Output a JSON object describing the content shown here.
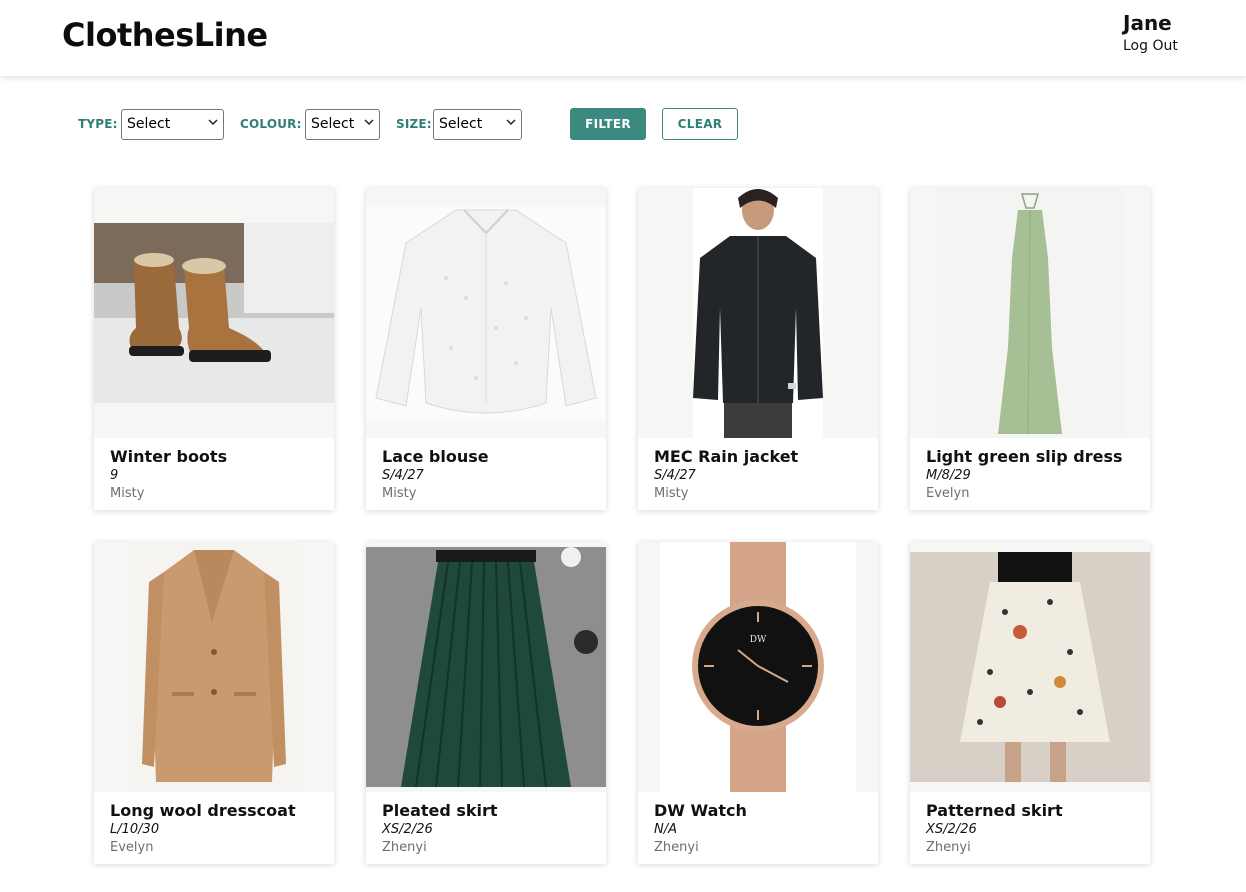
{
  "header": {
    "brand": "ClothesLine",
    "user_name": "Jane",
    "logout_label": "Log Out"
  },
  "filters": {
    "type_label": "TYPE:",
    "type_value": "Select",
    "colour_label": "COLOUR:",
    "colour_value": "Select",
    "size_label": "SIZE:",
    "size_value": "Select",
    "filter_button": "FILTER",
    "clear_button": "CLEAR"
  },
  "colors": {
    "accent": "#3c8a7f",
    "accent_text": "#2f7f74"
  },
  "items": [
    {
      "title": "Winter boots",
      "size": "9",
      "owner": "Misty",
      "image": "winter-boots-image"
    },
    {
      "title": "Lace blouse",
      "size": "S/4/27",
      "owner": "Misty",
      "image": "lace-blouse-image"
    },
    {
      "title": "MEC Rain jacket",
      "size": "S/4/27",
      "owner": "Misty",
      "image": "rain-jacket-image"
    },
    {
      "title": "Light green slip dress",
      "size": "M/8/29",
      "owner": "Evelyn",
      "image": "slip-dress-image"
    },
    {
      "title": "Long wool dresscoat",
      "size": "L/10/30",
      "owner": "Evelyn",
      "image": "wool-coat-image"
    },
    {
      "title": "Pleated skirt",
      "size": "XS/2/26",
      "owner": "Zhenyi",
      "image": "pleated-skirt-image"
    },
    {
      "title": "DW Watch",
      "size": "N/A",
      "owner": "Zhenyi",
      "image": "watch-image"
    },
    {
      "title": "Patterned skirt",
      "size": "XS/2/26",
      "owner": "Zhenyi",
      "image": "patterned-skirt-image"
    }
  ]
}
